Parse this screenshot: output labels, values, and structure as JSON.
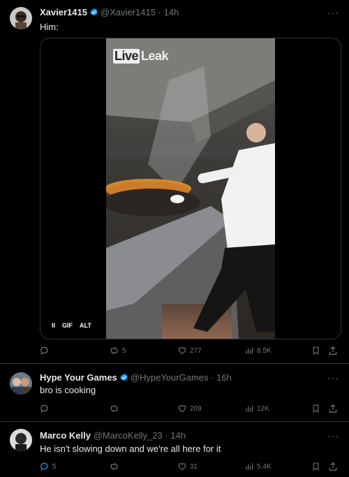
{
  "tweets": [
    {
      "name": "Xavier1415",
      "handle": "@Xavier1415",
      "time": "· 14h",
      "text": "Him:",
      "verified": true,
      "media": {
        "watermark_part1": "Live",
        "watermark_part2": "Leak",
        "pause_label": "II",
        "gif_label": "GIF",
        "alt_label": "ALT"
      },
      "replies": "",
      "retweets": "5",
      "likes": "277",
      "views": "8.5K"
    },
    {
      "name": "Hype Your Games",
      "handle": "@HypeYourGames",
      "time": "· 16h",
      "text": "bro is cooking",
      "verified": true,
      "replies": "",
      "retweets": "",
      "likes": "209",
      "views": "12K"
    },
    {
      "name": "Marco Kelly",
      "handle": "@MarcoKelly_23",
      "time": "· 14h",
      "text": "He isn't slowing down and we're all here for it",
      "verified": false,
      "replies": "5",
      "retweets": "",
      "likes": "31",
      "views": "5.4K"
    }
  ],
  "more_label": "···",
  "colors": {
    "background": "#000000",
    "text": "#e7e9ea",
    "muted": "#71767b",
    "verified": "#1d9bf0",
    "divider": "#2f3336"
  },
  "icons": [
    "reply-icon",
    "retweet-icon",
    "like-icon",
    "views-icon",
    "bookmark-icon",
    "share-icon",
    "verified-badge-icon",
    "more-icon"
  ]
}
